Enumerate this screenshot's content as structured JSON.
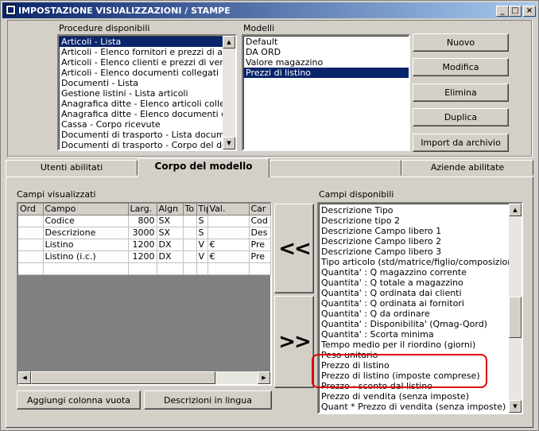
{
  "window": {
    "title": "IMPOSTAZIONE VISUALIZZAZIONI / STAMPE",
    "min": "_",
    "max": "□",
    "close": "×"
  },
  "procedures": {
    "label": "Procedure disponibili",
    "items": [
      "Articoli - Lista",
      "Articoli - Elenco fornitori e prezzi di acquisto",
      "Articoli - Elenco clienti e prezzi di vendita per",
      "Articoli - Elenco documenti collegati",
      "Documenti - Lista",
      "Gestione listini - Lista articoli",
      "Anagrafica ditte - Elenco articoli collegati",
      "Anagrafica ditte - Elenco documenti collegati",
      "Cassa - Corpo ricevute",
      "Documenti di trasporto - Lista documenti",
      "Documenti di trasporto - Corpo del documento"
    ],
    "selected_index": 0
  },
  "models": {
    "label": "Modelli",
    "items": [
      "Default",
      "DA ORD",
      "Valore magazzino",
      "Prezzi di listino"
    ],
    "selected_index": 3
  },
  "buttons": {
    "nuovo": "Nuovo",
    "modifica": "Modifica",
    "elimina": "Elimina",
    "duplica": "Duplica",
    "import": "Import da archivio",
    "add_column": "Aggiungi colonna vuota",
    "descriptions": "Descrizioni in lingua",
    "move_left": "<<",
    "move_right": ">>"
  },
  "tabs": [
    "Utenti abilitati",
    "Corpo del modello",
    "",
    "Aziende abilitate"
  ],
  "active_tab": 1,
  "visible_fields": {
    "label": "Campi visualizzati",
    "columns": [
      "Ord",
      "Campo",
      "Larg.",
      "Algn",
      "To",
      "Tip",
      "Val.",
      "Car"
    ],
    "rows": [
      [
        "",
        "Codice",
        "800",
        "SX",
        "",
        "S",
        "",
        "Cod"
      ],
      [
        "",
        "Descrizione",
        "3000",
        "SX",
        "",
        "S",
        "",
        "Des"
      ],
      [
        "",
        "Listino",
        "1200",
        "DX",
        "",
        "V",
        "€",
        "Pre"
      ],
      [
        "",
        "Listino (i.c.)",
        "1200",
        "DX",
        "",
        "V",
        "€",
        "Pre"
      ],
      [
        "",
        "",
        "",
        "",
        "",
        "",
        "",
        ""
      ]
    ]
  },
  "available_fields": {
    "label": "Campi disponibili",
    "items": [
      "Descrizione Tipo",
      "Descrizione tipo 2",
      "Descrizione Campo libero 1",
      "Descrizione Campo libero 2",
      "Descrizione Campo libero 3",
      "Tipo articolo (std/matrice/figlio/composizione)",
      "Quantita' : Q magazzino corrente",
      "Quantita' : Q totale a magazzino",
      "Quantita' : Q ordinata dai clienti",
      "Quantita' : Q ordinata ai fornitori",
      "Quantita' : Q da ordinare",
      "Quantita' : Disponibilita' (Qmag-Qord)",
      "Quantita' : Scorta minima",
      "Tempo medio per il riordino (giorni)",
      "Peso unitario",
      "Prezzo di listino",
      "Prezzo di listino (imposte comprese)",
      "Prezzo - sconto dal listino",
      "Prezzo di vendita (senza imposte)",
      "Quant * Prezzo di vendita (senza imposte)"
    ]
  },
  "colors": {
    "highlight": "#0a246a",
    "annotation": "#e00000",
    "face": "#d4d0c8"
  }
}
